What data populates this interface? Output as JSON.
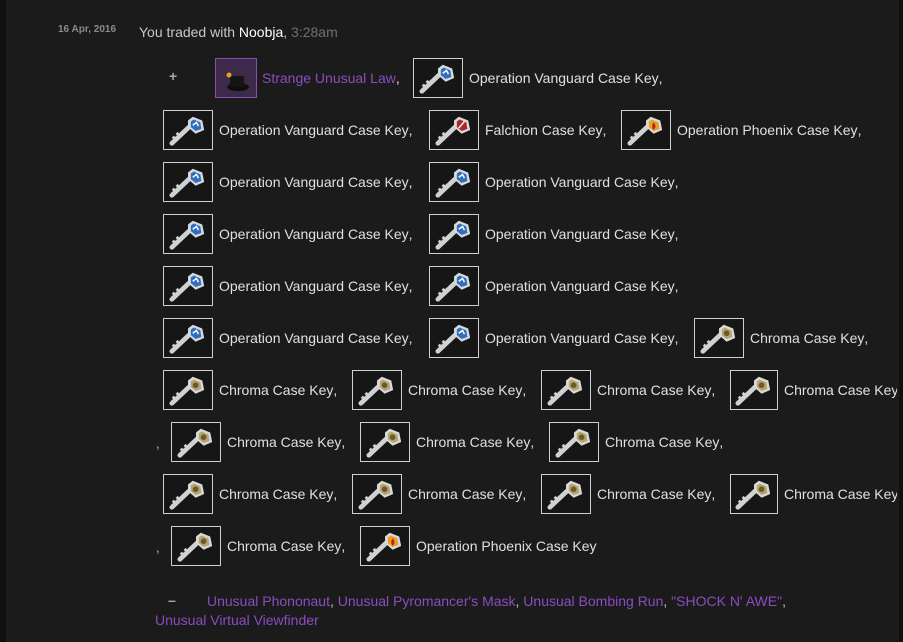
{
  "trade": {
    "date": "16 Apr, 2016",
    "prefix": "You traded with ",
    "user": "Noobja",
    "comma": ",",
    "time": " 3:28am"
  },
  "signs": {
    "gave": "+",
    "received": "–"
  },
  "gave": {
    "unusual_label": "Strange Unusual Law",
    "vanguard": "Operation Vanguard Case Key",
    "falchion": "Falchion Case Key",
    "phoenix": "Operation Phoenix Case Key",
    "chroma": "Chroma Case Key",
    "chroma_cut": "Chroma Case Key"
  },
  "received": {
    "items": [
      "Unusual Phononaut",
      "Unusual Pyromancer's Mask",
      "Unusual Bombing Run",
      "\"SHOCK N' AWE\"",
      "Unusual Virtual Viewfinder"
    ]
  },
  "colors": {
    "background": "#1b1b1c",
    "unusual": "#8b4cc0",
    "vanguard_key": "#2f6fc0",
    "falchion_key": "#b0262a",
    "phoenix_key": "#e8a020",
    "chroma_key": "#b7a46a"
  },
  "icons": {
    "unusual_hat": "hat-icon",
    "key": "key-icon"
  }
}
